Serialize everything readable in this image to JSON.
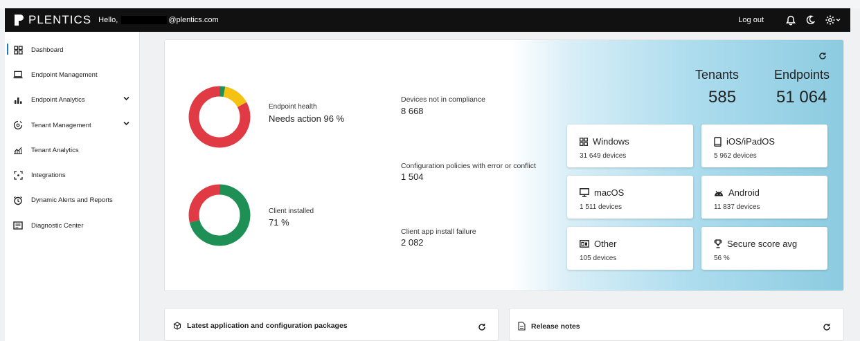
{
  "header": {
    "brand": "PLENTICS",
    "greeting": "Hello,",
    "email_suffix": "@plentics.com",
    "logout": "Log out"
  },
  "sidebar": {
    "items": [
      {
        "label": "Dashboard",
        "icon": "dashboard-icon",
        "active": true
      },
      {
        "label": "Endpoint Management",
        "icon": "laptop-icon"
      },
      {
        "label": "Endpoint Analytics",
        "icon": "bar-chart-icon",
        "expandable": true
      },
      {
        "label": "Tenant Management",
        "icon": "tenant-gear-icon",
        "expandable": true
      },
      {
        "label": "Tenant Analytics",
        "icon": "tenant-analytics-icon"
      },
      {
        "label": "Integrations",
        "icon": "integrations-icon"
      },
      {
        "label": "Dynamic Alerts and Reports",
        "icon": "alarm-clock-icon"
      },
      {
        "label": "Diagnostic Center",
        "icon": "diagnostic-icon"
      }
    ]
  },
  "health": {
    "endpoint_label": "Endpoint health",
    "endpoint_value": "Needs action 96 %",
    "client_label": "Client installed",
    "client_value": "71 %",
    "endpoint_share": {
      "needs_action": 0.83,
      "ok": 0.03,
      "warning": 0.14
    },
    "client_share": {
      "installed": 0.71,
      "not_installed": 0.29
    }
  },
  "stats": [
    {
      "label": "Devices not in compliance",
      "value": "8 668"
    },
    {
      "label": "Configuration policies with error or conflict",
      "value": "1 504"
    },
    {
      "label": "Client app install failure",
      "value": "2 082"
    }
  ],
  "totals": {
    "tenants_label": "Tenants",
    "tenants_value": "585",
    "endpoints_label": "Endpoints",
    "endpoints_value": "51 064"
  },
  "tiles": [
    {
      "title": "Windows",
      "sub": "31 649 devices",
      "icon": "windows-icon"
    },
    {
      "title": "iOS/iPadOS",
      "sub": "5 962 devices",
      "icon": "tablet-icon"
    },
    {
      "title": "macOS",
      "sub": "1 511 devices",
      "icon": "monitor-icon"
    },
    {
      "title": "Android",
      "sub": "11 837 devices",
      "icon": "android-icon"
    },
    {
      "title": "Other",
      "sub": "105 devices",
      "icon": "other-devices-icon"
    },
    {
      "title": "Secure score avg",
      "sub": "56 %",
      "icon": "trophy-icon"
    }
  ],
  "bottom": {
    "packages_title": "Latest application and configuration packages",
    "release_title": "Release notes"
  },
  "colors": {
    "red": "#e03a45",
    "green": "#1e8f55",
    "yellow": "#f5c112",
    "accent": "#1f7ab8"
  }
}
